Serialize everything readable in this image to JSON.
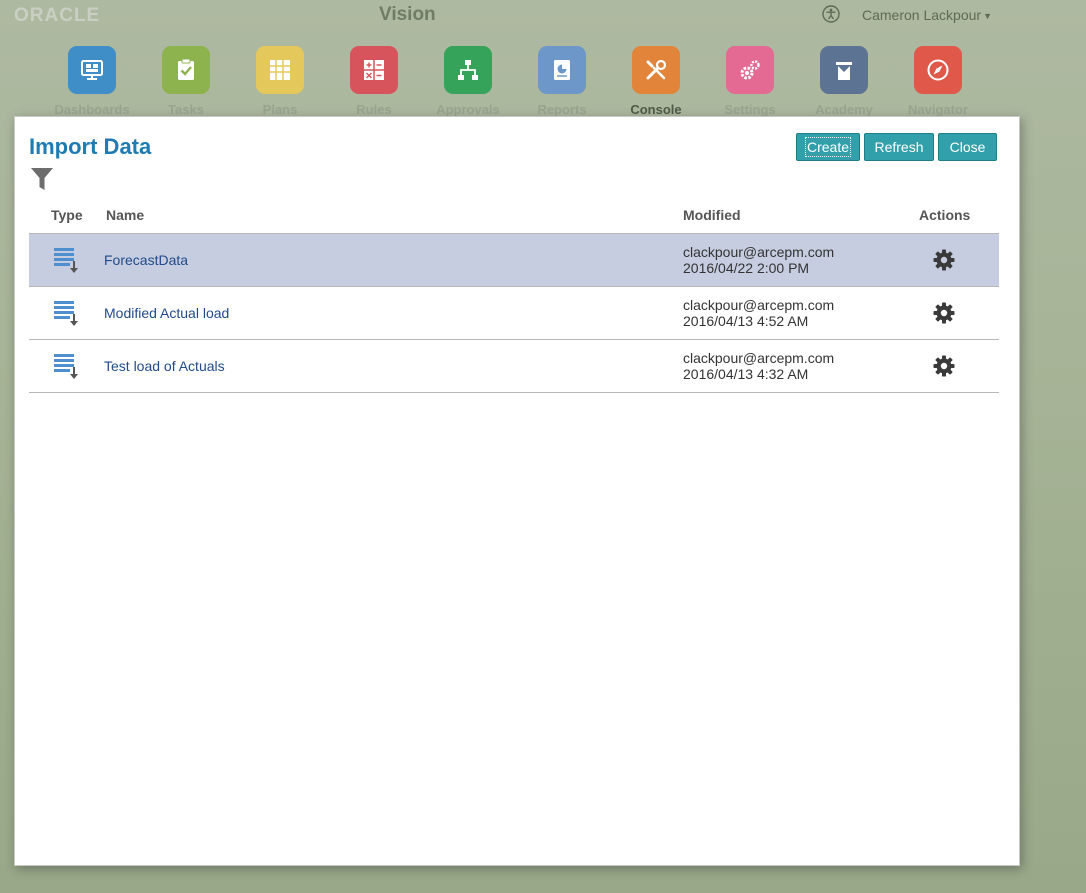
{
  "header": {
    "logo": "ORACLE",
    "app_title": "Vision",
    "user_name": "Cameron Lackpour",
    "user_caret": "▼"
  },
  "nav": {
    "items": [
      {
        "label": "Dashboards",
        "icon": "dashboards-icon",
        "color": "#3f8ec8"
      },
      {
        "label": "Tasks",
        "icon": "tasks-icon",
        "color": "#8cb34e"
      },
      {
        "label": "Plans",
        "icon": "plans-icon",
        "color": "#e4c85c"
      },
      {
        "label": "Rules",
        "icon": "rules-icon",
        "color": "#d8545c"
      },
      {
        "label": "Approvals",
        "icon": "approvals-icon",
        "color": "#36a35a"
      },
      {
        "label": "Reports",
        "icon": "reports-icon",
        "color": "#6d97c9"
      },
      {
        "label": "Console",
        "icon": "console-icon",
        "color": "#e2843a",
        "active": true
      },
      {
        "label": "Settings",
        "icon": "settings-icon",
        "color": "#e46a94"
      },
      {
        "label": "Academy",
        "icon": "academy-icon",
        "color": "#5d7393"
      },
      {
        "label": "Navigator",
        "icon": "navigator-icon",
        "color": "#e0584a"
      }
    ]
  },
  "dialog": {
    "title": "Import Data",
    "buttons": {
      "create": "Create",
      "refresh": "Refresh",
      "close": "Close"
    },
    "columns": {
      "type": "Type",
      "name": "Name",
      "modified": "Modified",
      "actions": "Actions"
    },
    "rows": [
      {
        "name": "ForecastData",
        "modified_by": "clackpour@arcepm.com",
        "modified_on": "2016/04/22 2:00 PM",
        "selected": true
      },
      {
        "name": "Modified Actual load",
        "modified_by": "clackpour@arcepm.com",
        "modified_on": "2016/04/13 4:52 AM"
      },
      {
        "name": "Test load of Actuals",
        "modified_by": "clackpour@arcepm.com",
        "modified_on": "2016/04/13 4:32 AM"
      }
    ]
  },
  "colors": {
    "accent_title": "#1f7cb2",
    "button_teal": "#31a0aa",
    "row_selected": "#c6cde0",
    "link_text": "#214b8c"
  }
}
